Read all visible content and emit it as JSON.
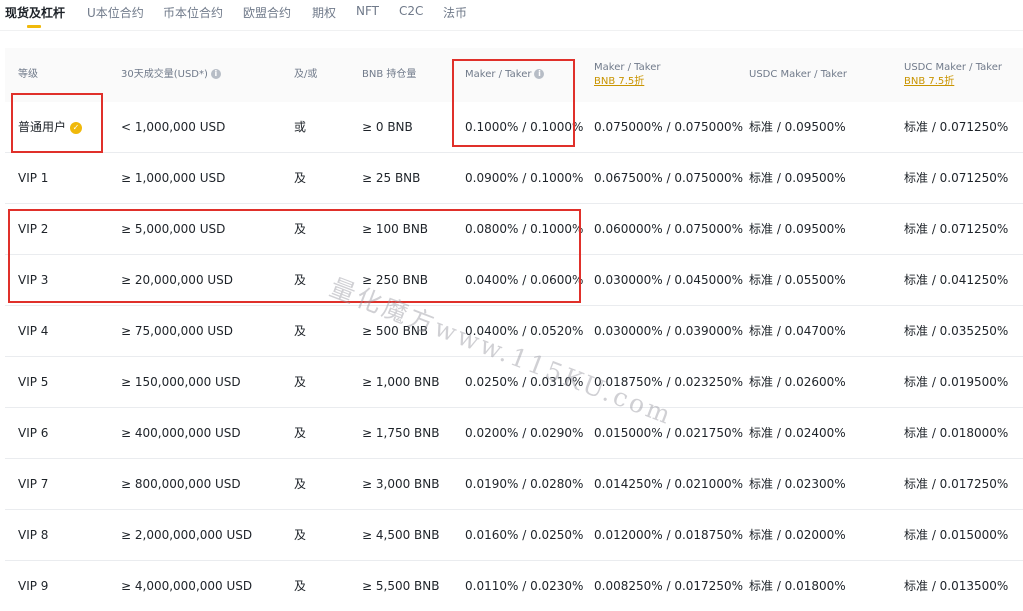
{
  "tabs": {
    "items": [
      {
        "label": "现货及杠杆",
        "active": true
      },
      {
        "label": "U本位合约"
      },
      {
        "label": "币本位合约"
      },
      {
        "label": "欧盟合约"
      },
      {
        "label": "期权"
      },
      {
        "label": "NFT"
      },
      {
        "label": "C2C"
      },
      {
        "label": "法币"
      }
    ]
  },
  "table": {
    "headers": {
      "level": "等级",
      "volume": "30天成交量(USD*)",
      "and_or": "及/或",
      "bnb_balance": "BNB 持仓量",
      "maker_taker": "Maker / Taker",
      "maker_taker_bnb": "Maker / Taker",
      "maker_taker_bnb_sub": "BNB 7.5折",
      "usdc_maker_taker": "USDC Maker / Taker",
      "usdc_maker_taker_bnb": "USDC Maker / Taker",
      "usdc_maker_taker_bnb_sub": "BNB 7.5折"
    },
    "rows": [
      {
        "level": "普通用户",
        "volume": "< 1,000,000 USD",
        "and_or": "或",
        "bnb": "≥ 0 BNB",
        "maker_taker": "0.1000% / 0.1000%",
        "maker_taker_bnb": "0.075000% / 0.075000%",
        "usdc": "标准 / 0.09500%",
        "usdc_bnb": "标准 / 0.071250%"
      },
      {
        "level": "VIP 1",
        "volume": "≥ 1,000,000 USD",
        "and_or": "及",
        "bnb": "≥ 25 BNB",
        "maker_taker": "0.0900% / 0.1000%",
        "maker_taker_bnb": "0.067500% / 0.075000%",
        "usdc": "标准 / 0.09500%",
        "usdc_bnb": "标准 / 0.071250%"
      },
      {
        "level": "VIP 2",
        "volume": "≥ 5,000,000 USD",
        "and_or": "及",
        "bnb": "≥ 100 BNB",
        "maker_taker": "0.0800% / 0.1000%",
        "maker_taker_bnb": "0.060000% / 0.075000%",
        "usdc": "标准 / 0.09500%",
        "usdc_bnb": "标准 / 0.071250%"
      },
      {
        "level": "VIP 3",
        "volume": "≥ 20,000,000 USD",
        "and_or": "及",
        "bnb": "≥ 250 BNB",
        "maker_taker": "0.0400% / 0.0600%",
        "maker_taker_bnb": "0.030000% / 0.045000%",
        "usdc": "标准 / 0.05500%",
        "usdc_bnb": "标准 / 0.041250%"
      },
      {
        "level": "VIP 4",
        "volume": "≥ 75,000,000 USD",
        "and_or": "及",
        "bnb": "≥ 500 BNB",
        "maker_taker": "0.0400% / 0.0520%",
        "maker_taker_bnb": "0.030000% / 0.039000%",
        "usdc": "标准 / 0.04700%",
        "usdc_bnb": "标准 / 0.035250%"
      },
      {
        "level": "VIP 5",
        "volume": "≥ 150,000,000 USD",
        "and_or": "及",
        "bnb": "≥ 1,000 BNB",
        "maker_taker": "0.0250% / 0.0310%",
        "maker_taker_bnb": "0.018750% / 0.023250%",
        "usdc": "标准 / 0.02600%",
        "usdc_bnb": "标准 / 0.019500%"
      },
      {
        "level": "VIP 6",
        "volume": "≥ 400,000,000 USD",
        "and_or": "及",
        "bnb": "≥ 1,750 BNB",
        "maker_taker": "0.0200% / 0.0290%",
        "maker_taker_bnb": "0.015000% / 0.021750%",
        "usdc": "标准 / 0.02400%",
        "usdc_bnb": "标准 / 0.018000%"
      },
      {
        "level": "VIP 7",
        "volume": "≥ 800,000,000 USD",
        "and_or": "及",
        "bnb": "≥ 3,000 BNB",
        "maker_taker": "0.0190% / 0.0280%",
        "maker_taker_bnb": "0.014250% / 0.021000%",
        "usdc": "标准 / 0.02300%",
        "usdc_bnb": "标准 / 0.017250%"
      },
      {
        "level": "VIP 8",
        "volume": "≥ 2,000,000,000 USD",
        "and_or": "及",
        "bnb": "≥ 4,500 BNB",
        "maker_taker": "0.0160% / 0.0250%",
        "maker_taker_bnb": "0.012000% / 0.018750%",
        "usdc": "标准 / 0.02000%",
        "usdc_bnb": "标准 / 0.015000%"
      },
      {
        "level": "VIP 9",
        "volume": "≥ 4,000,000,000 USD",
        "and_or": "及",
        "bnb": "≥ 5,500 BNB",
        "maker_taker": "0.0110% / 0.0230%",
        "maker_taker_bnb": "0.008250% / 0.017250%",
        "usdc": "标准 / 0.01800%",
        "usdc_bnb": "标准 / 0.013500%"
      }
    ]
  },
  "watermark": {
    "text": "量化魔方www.115KU.com"
  },
  "colors": {
    "accent": "#f0b90b",
    "highlight_box": "#e0302a",
    "muted": "#707a8a"
  }
}
